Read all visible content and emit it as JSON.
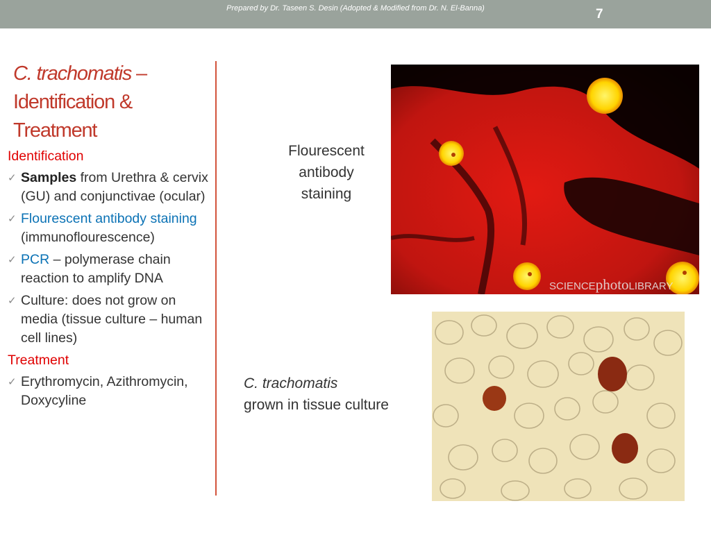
{
  "header": {
    "credit": "Prepared by Dr. Taseen S. Desin (Adopted & Modified from Dr. N. El-Banna)",
    "page_number": "7"
  },
  "title": {
    "line1_italic": "C. trachomatis",
    "line1_rest": " –",
    "line2": "Identification &",
    "line3": "Treatment"
  },
  "content": {
    "identification_heading": "Identification",
    "bullets": [
      {
        "bold": "Samples",
        "text": " from Urethra & cervix (GU) and conjunctivae (ocular)"
      },
      {
        "blue": "Flourescent antibody staining",
        "text": " (immunoflourescence)"
      },
      {
        "blue": "PCR",
        "text": " – polymerase chain reaction to amplify DNA"
      },
      {
        "text": "Culture: does not grow on media (tissue culture – human cell lines)"
      }
    ],
    "treatment_heading": "Treatment",
    "treatment_bullet": "Erythromycin, Azithromycin, Doxycyline"
  },
  "captions": {
    "fa": [
      "Flourescent",
      "antibody",
      "staining"
    ],
    "tc_italic": "C. trachomatis",
    "tc_rest": "grown in tissue culture"
  },
  "watermark": {
    "part1": "SCIENCE",
    "part2": "photo",
    "part3": "LIBRARY"
  },
  "icons": {
    "bullet": "checkmark-icon"
  },
  "colors": {
    "title": "#c0392b",
    "heading": "#e00000",
    "link_blue": "#0b72b5",
    "topbar": "#9aa39c",
    "divider": "#d2533b"
  }
}
